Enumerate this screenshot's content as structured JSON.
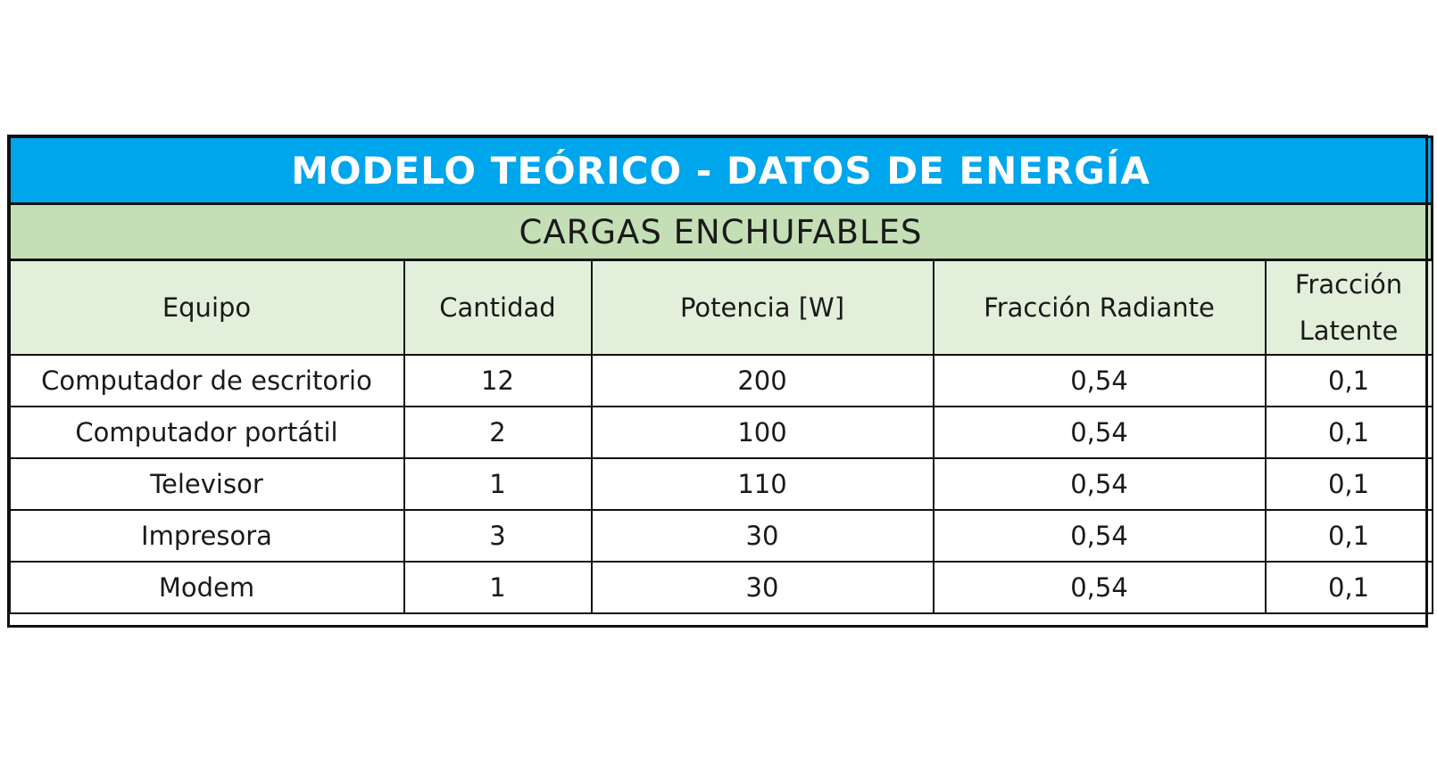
{
  "colors": {
    "title_bg": "#00a6ec",
    "section_bg": "#c4dfb5",
    "header_bg": "#e2efda",
    "row_bg": "#ffffff",
    "border": "#111111"
  },
  "title": "MODELO TEÓRICO - DATOS DE ENERGÍA",
  "section": "CARGAS ENCHUFABLES",
  "columns": [
    "Equipo",
    "Cantidad",
    "Potencia [W]",
    "Fracción Radiante",
    "Fracción Latente"
  ],
  "rows": [
    [
      "Computador de escritorio",
      "12",
      "200",
      "0,54",
      "0,1"
    ],
    [
      "Computador portátil",
      "2",
      "100",
      "0,54",
      "0,1"
    ],
    [
      "Televisor",
      "1",
      "110",
      "0,54",
      "0,1"
    ],
    [
      "Impresora",
      "3",
      "30",
      "0,54",
      "0,1"
    ],
    [
      "Modem",
      "1",
      "30",
      "0,54",
      "0,1"
    ]
  ]
}
